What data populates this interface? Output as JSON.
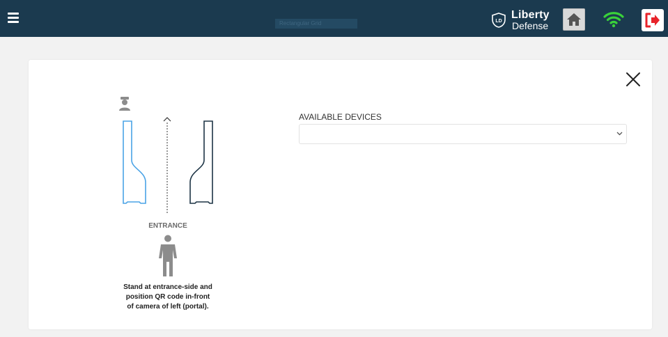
{
  "header": {
    "hidden_label": "Rectangular Grid",
    "brand": {
      "line1": "Liberty",
      "line2": "Defense",
      "badge": "LD"
    },
    "icons": [
      "menu-icon",
      "home-icon",
      "wifi-icon",
      "logout-icon"
    ],
    "colors": {
      "bar": "#1b3a4f",
      "wifi": "#3ad23a",
      "logout": "#e8232a"
    }
  },
  "diagram": {
    "guard_icon": "security-guard-icon",
    "entrance_label": "ENTRANCE",
    "person_icon": "person-icon",
    "instructions": [
      "Stand at entrance-side and",
      "position QR code in-front",
      "of camera of left (portal)."
    ],
    "colors": {
      "left_portal": "#4aa3e6",
      "right_portal": "#1d3445"
    }
  },
  "devices": {
    "label": "AVAILABLE DEVICES",
    "selected": ""
  }
}
